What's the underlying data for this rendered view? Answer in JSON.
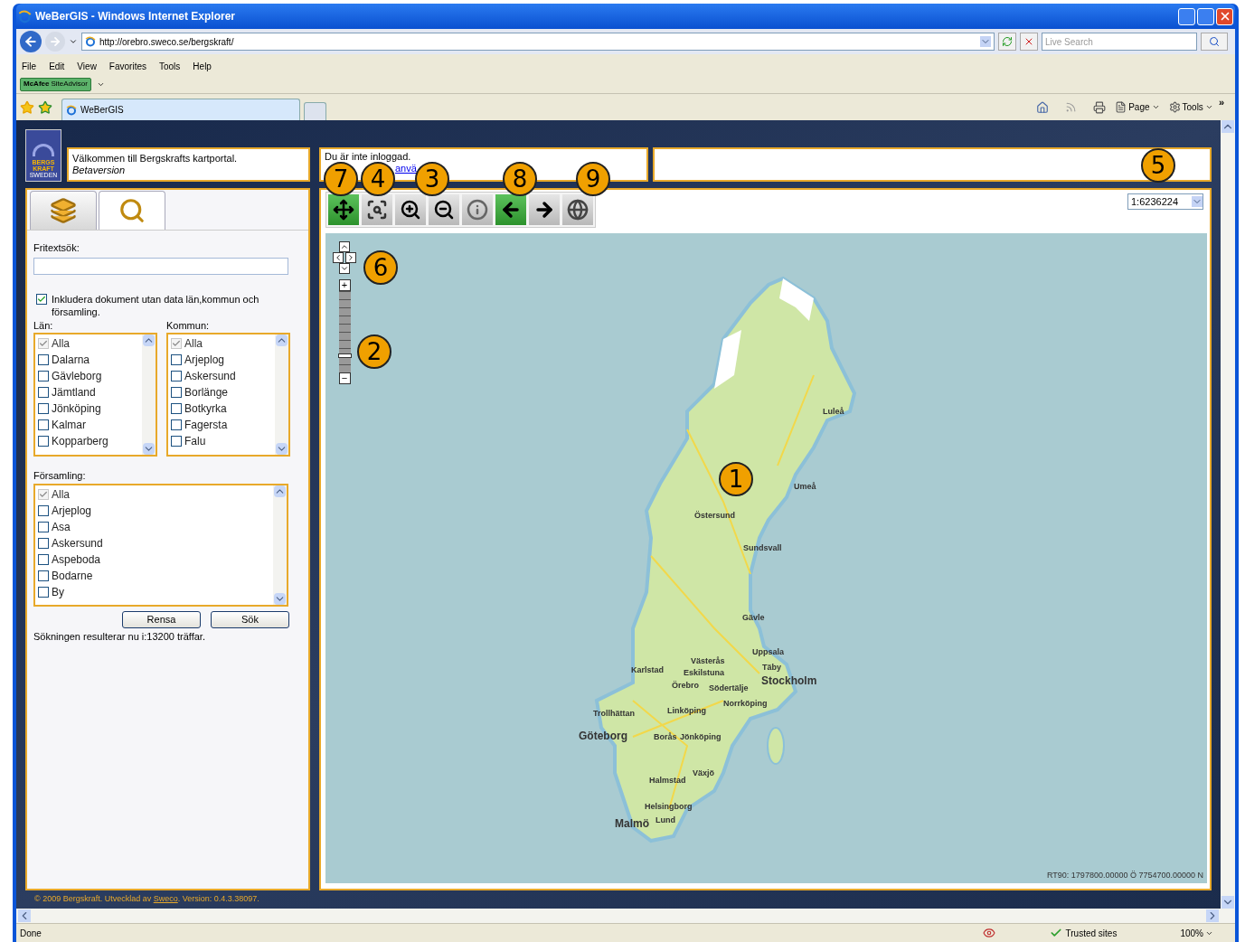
{
  "window": {
    "title": "WeBerGIS - Windows Internet Explorer"
  },
  "address_bar": {
    "url": "http://orebro.sweco.se/bergskraft/"
  },
  "search": {
    "placeholder": "Live Search"
  },
  "menu": [
    "File",
    "Edit",
    "View",
    "Favorites",
    "Tools",
    "Help"
  ],
  "siteadvisor": {
    "brand": "McAfee",
    "label": "SiteAdvisor"
  },
  "browser_tabs": [
    {
      "label": "WeBerGIS",
      "selected": true
    }
  ],
  "command_bar": [
    "Page",
    "Tools"
  ],
  "command_more": "»",
  "logo": {
    "line_1": "BERGS",
    "line_2": "KRAFT",
    "line_3": "SWEDEN"
  },
  "welcome": {
    "text": "Välkommen till Bergskrafts kartportal.",
    "subtitle": "Betaversion"
  },
  "login": {
    "text": "Du är inte inloggad.",
    "link": "anvä"
  },
  "panel_tabs": [
    {
      "kind": "layers",
      "selected": false
    },
    {
      "kind": "search",
      "selected": true
    }
  ],
  "search_form": {
    "label": "Fritextsök:",
    "include_checkbox": {
      "label": "Inkludera dokument utan data län,kommun och församling.",
      "checked": true
    },
    "lists": [
      {
        "label": "Län:",
        "items": [
          {
            "label": "Alla",
            "checked": true,
            "disabled": true
          },
          {
            "label": "Dalarna",
            "checked": false,
            "disabled": false
          },
          {
            "label": "Gävleborg",
            "checked": false,
            "disabled": false
          },
          {
            "label": "Jämtland",
            "checked": false,
            "disabled": false
          },
          {
            "label": "Jönköping",
            "checked": false,
            "disabled": false
          },
          {
            "label": "Kalmar",
            "checked": false,
            "disabled": false
          },
          {
            "label": "Kopparberg",
            "checked": false,
            "disabled": false
          }
        ]
      },
      {
        "label": "Kommun:",
        "items": [
          {
            "label": "Alla",
            "checked": true,
            "disabled": true
          },
          {
            "label": "Arjeplog",
            "checked": false,
            "disabled": false
          },
          {
            "label": "Askersund",
            "checked": false,
            "disabled": false
          },
          {
            "label": "Borlänge",
            "checked": false,
            "disabled": false
          },
          {
            "label": "Botkyrka",
            "checked": false,
            "disabled": false
          },
          {
            "label": "Fagersta",
            "checked": false,
            "disabled": false
          },
          {
            "label": "Falu",
            "checked": false,
            "disabled": false
          }
        ]
      },
      {
        "label": "Församling:",
        "items": [
          {
            "label": "Alla",
            "checked": true,
            "disabled": true
          },
          {
            "label": "Arjeplog",
            "checked": false,
            "disabled": false
          },
          {
            "label": "Asa",
            "checked": false,
            "disabled": false
          },
          {
            "label": "Askersund",
            "checked": false,
            "disabled": false
          },
          {
            "label": "Aspeboda",
            "checked": false,
            "disabled": false
          },
          {
            "label": "Bodarne",
            "checked": false,
            "disabled": false
          },
          {
            "label": "By",
            "checked": false,
            "disabled": false
          }
        ]
      }
    ],
    "buttons": [
      "Rensa",
      "Sök"
    ],
    "result": "Sökningen resulterar nu i:13200 träffar."
  },
  "map_tools": [
    {
      "kind": "pan",
      "active": true
    },
    {
      "kind": "zoom-box",
      "active": false
    },
    {
      "kind": "zoom-in",
      "active": false
    },
    {
      "kind": "zoom-out",
      "active": false
    },
    {
      "kind": "info",
      "active": false
    },
    {
      "kind": "back",
      "active": true
    },
    {
      "kind": "forward",
      "active": false
    },
    {
      "kind": "globe",
      "active": false
    }
  ],
  "scale": {
    "value": "1:6236224"
  },
  "zoom_slider": {
    "plus": "+",
    "minus": "−",
    "level": 0.2
  },
  "cities": [
    {
      "name": "Luleå",
      "major": false
    },
    {
      "name": "Umeå",
      "major": false
    },
    {
      "name": "Östersund",
      "major": false
    },
    {
      "name": "Sundsvall",
      "major": false
    },
    {
      "name": "Gävle",
      "major": false
    },
    {
      "name": "Uppsala",
      "major": false
    },
    {
      "name": "Karlstad",
      "major": false
    },
    {
      "name": "Västerås",
      "major": false
    },
    {
      "name": "Eskilstuna",
      "major": false
    },
    {
      "name": "Täby",
      "major": false
    },
    {
      "name": "Stockholm",
      "major": true
    },
    {
      "name": "Örebro",
      "major": false
    },
    {
      "name": "Södertälje",
      "major": false
    },
    {
      "name": "Norrköping",
      "major": false
    },
    {
      "name": "Trollhättan",
      "major": false
    },
    {
      "name": "Linköping",
      "major": false
    },
    {
      "name": "Göteborg",
      "major": true
    },
    {
      "name": "Borås",
      "major": false
    },
    {
      "name": "Jönköping",
      "major": false
    },
    {
      "name": "Växjö",
      "major": false
    },
    {
      "name": "Halmstad",
      "major": false
    },
    {
      "name": "Helsingborg",
      "major": false
    },
    {
      "name": "Malmö",
      "major": true
    },
    {
      "name": "Lund",
      "major": false
    }
  ],
  "coordinates": "RT90: 1797800.00000 Ö 7754700.00000 N",
  "footer": {
    "before": "© 2009 Bergskraft. Utvecklad av ",
    "link": "Sweco",
    "after": ". Version: 0.4.3.38097."
  },
  "callouts": [
    "7",
    "4",
    "3",
    "8",
    "9",
    "5",
    "6",
    "2",
    "1"
  ],
  "status_bar": {
    "text": "Done",
    "zone": "Trusted sites",
    "zoom": "100%"
  }
}
